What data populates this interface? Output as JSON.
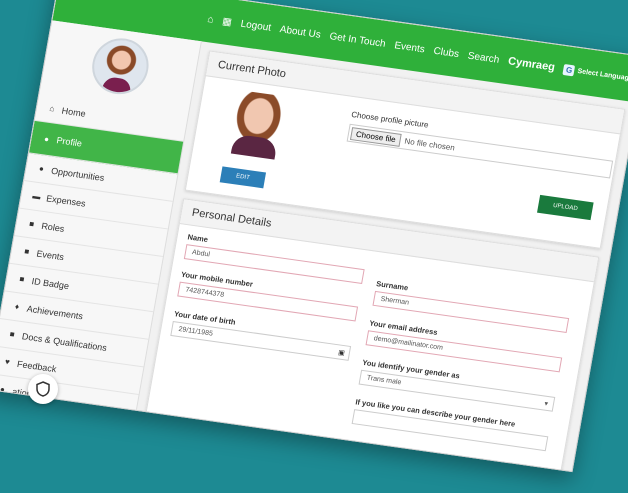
{
  "topnav": {
    "items": [
      "Logout",
      "About Us",
      "Get In Touch",
      "Events",
      "Clubs",
      "Search"
    ],
    "cymraeg": "Cymraeg",
    "select_language": "Select Language"
  },
  "sidebar": {
    "items": [
      {
        "label": "Home",
        "icon": "home-icon",
        "glyph": "⌂"
      },
      {
        "label": "Profile",
        "icon": "user-icon",
        "glyph": "●"
      },
      {
        "label": "Opportunities",
        "icon": "globe-icon",
        "glyph": "●"
      },
      {
        "label": "Expenses",
        "icon": "money-icon",
        "glyph": "▬"
      },
      {
        "label": "Roles",
        "icon": "briefcase-icon",
        "glyph": "■"
      },
      {
        "label": "Events",
        "icon": "calendar-icon",
        "glyph": "■"
      },
      {
        "label": "ID Badge",
        "icon": "id-badge-icon",
        "glyph": "■"
      },
      {
        "label": "Achievements",
        "icon": "trophy-icon",
        "glyph": "♦"
      },
      {
        "label": "Docs & Qualifications",
        "icon": "document-icon",
        "glyph": "■"
      },
      {
        "label": "Feedback",
        "icon": "heart-icon",
        "glyph": "♥"
      },
      {
        "label": "ations",
        "icon": "notification-icon",
        "glyph": "●"
      }
    ],
    "active_index": 1
  },
  "current_photo": {
    "title": "Current Photo",
    "choose_label": "Choose profile picture",
    "file_button": "Choose file",
    "file_status": "No file chosen",
    "edit_button": "EDIT",
    "upload_button": "UPLOAD"
  },
  "personal": {
    "title": "Personal Details",
    "name_label": "Name",
    "name_value": "Abdul",
    "surname_label": "Surname",
    "surname_value": "Sherman",
    "mobile_label": "Your mobile number",
    "mobile_value": "7428744378",
    "email_label": "Your email address",
    "email_value": "demo@mailinator.com",
    "dob_label": "Your date of birth",
    "dob_value": "29/11/1985",
    "gender_label": "You identify your gender as",
    "gender_value": "Trans male",
    "gender_desc_label": "If you like you can describe your gender here"
  },
  "colors": {
    "background": "#1d8a93",
    "nav_green": "#2fb03a",
    "active_green": "#41b548",
    "edit_blue": "#2c7fb8",
    "upload_green": "#1a7a3d"
  }
}
